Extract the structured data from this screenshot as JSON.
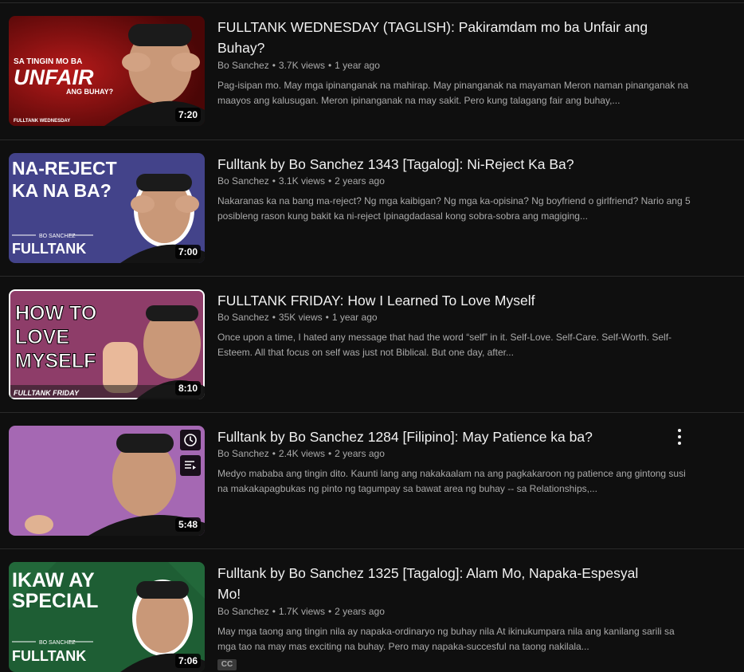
{
  "videos": [
    {
      "title": "FULLTANK WEDNESDAY (TAGLISH): Pakiramdam mo ba Unfair ang Buhay?",
      "channel": "Bo Sanchez",
      "views": "3.7K views",
      "age": "1 year ago",
      "description": "Pag-isipan mo. May mga ipinanganak na mahirap. May pinanganak na mayaman Meron naman pinanganak na maayos ang kalusugan. Meron ipinanganak na may sakit. Pero kung talagang fair ang buhay,...",
      "duration": "7:20",
      "thumb_text": {
        "line1": "SA TINGIN MO BA",
        "line2": "UNFAIR",
        "line3": "ANG BUHAY?",
        "footer": "FULLTANK WEDNESDAY"
      }
    },
    {
      "title": "Fulltank by Bo Sanchez 1343 [Tagalog]: Ni-Reject Ka Ba?",
      "channel": "Bo Sanchez",
      "views": "3.1K views",
      "age": "2 years ago",
      "description": "Nakaranas ka na bang ma-reject? Ng mga kaibigan? Ng mga ka-opisina? Ng boyfriend o girlfriend? Nario ang 5 posibleng rason kung bakit ka ni-reject Ipinagdadasal kong sobra-sobra ang magiging...",
      "duration": "7:00",
      "thumb_text": {
        "line1": "NA-REJECT",
        "line2": "KA NA BA?",
        "brand_small": "BO SANCHEZ",
        "brand": "FULLTANK"
      }
    },
    {
      "title": "FULLTANK FRIDAY: How I Learned To Love Myself",
      "channel": "Bo Sanchez",
      "views": "35K views",
      "age": "1 year ago",
      "description": "Once upon a time, I hated any message that had the word “self” in it. Self-Love. Self-Care. Self-Worth. Self-Esteem. All that focus on self was just not Biblical. But one day, after...",
      "duration": "8:10",
      "thumb_text": {
        "line1": "HOW TO",
        "line2": "LOVE",
        "line3": "MYSELF",
        "footer": "FULLTANK FRIDAY"
      }
    },
    {
      "title": "Fulltank by Bo Sanchez 1284 [Filipino]: May Patience ka ba?",
      "channel": "Bo Sanchez",
      "views": "2.4K views",
      "age": "2 years ago",
      "description": "Medyo mababa ang tingin dito. Kaunti lang ang nakakaalam na ang pagkakaroon ng patience ang gintong susi na makakapagbukas ng pinto ng tagumpay sa bawat area ng buhay -- sa Relationships,...",
      "duration": "5:48"
    },
    {
      "title": "Fulltank by Bo Sanchez 1325 [Tagalog]: Alam Mo, Napaka-Espesyal Mo!",
      "channel": "Bo Sanchez",
      "views": "1.7K views",
      "age": "2 years ago",
      "description": "May mga taong ang tingin nila ay napaka-ordinaryo ng buhay nila At ikinukumpara nila ang kanilang sarili sa mga tao na may mas exciting na buhay. Pero may napaka-succesful na taong nakilala...",
      "duration": "7:06",
      "badge": "CC",
      "thumb_text": {
        "line1": "IKAW AY",
        "line2": "SPECIAL",
        "brand_small": "BO SANCHEZ",
        "brand": "FULLTANK"
      }
    }
  ],
  "colors": {
    "background": "#0f0f0f",
    "text_primary": "#f1f1f1",
    "text_secondary": "#aaaaaa"
  },
  "icons": [
    "watch-later-icon",
    "add-to-queue-icon",
    "more-actions-icon"
  ]
}
